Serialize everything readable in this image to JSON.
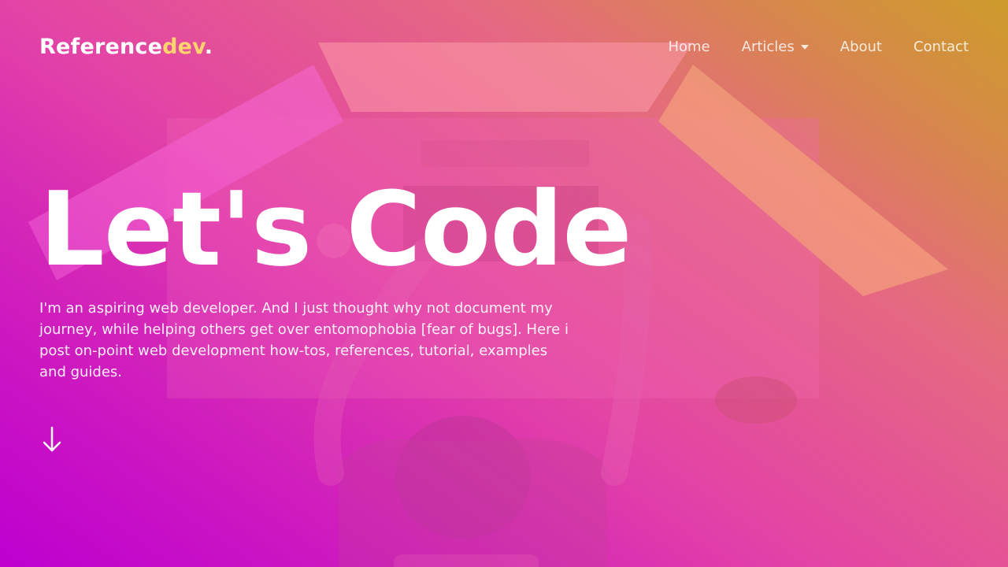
{
  "brand": {
    "name": "Reference",
    "accent": "dev",
    "suffix": ".",
    "accent_color": "#ffd36e"
  },
  "nav": {
    "items": [
      {
        "label": "Home"
      },
      {
        "label": "Articles",
        "has_dropdown": true
      },
      {
        "label": "About"
      },
      {
        "label": "Contact"
      }
    ]
  },
  "hero": {
    "title": "Let's Code",
    "description": "I'm an aspiring web developer. And I just thought why not document my journey, while helping others get over entomophobia [fear of bugs]. Here i post on-point web development how-tos, references, tutorial, examples and guides.",
    "scroll_icon": "arrow-down-icon"
  },
  "colors": {
    "gradient_start": "#c000cc",
    "gradient_end": "#cf9a30",
    "text": "#ffffff"
  }
}
